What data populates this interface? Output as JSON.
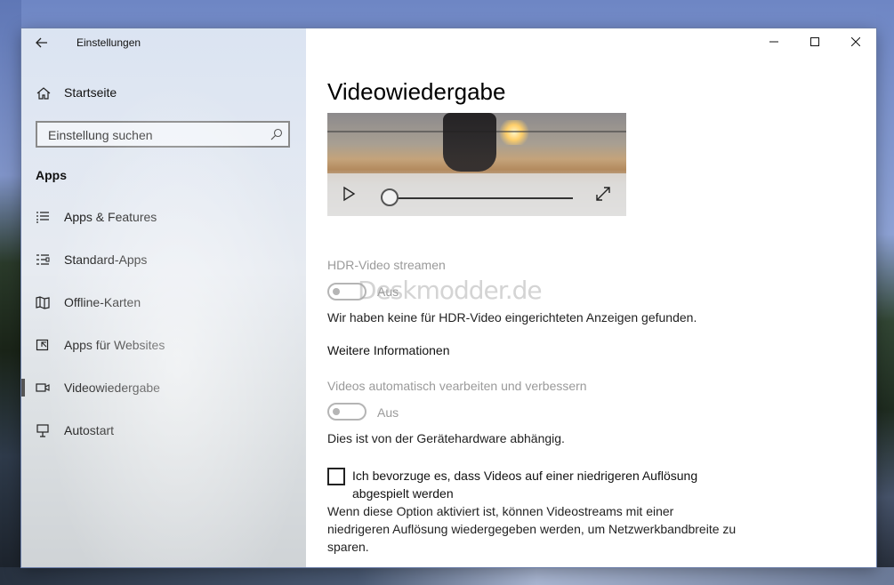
{
  "window": {
    "title": "Einstellungen",
    "back_label": "←",
    "minimize_glyph": "—",
    "maximize_glyph": "☐",
    "close_glyph": "✕"
  },
  "sidebar": {
    "home_label": "Startseite",
    "search_placeholder": "Einstellung suchen",
    "section_title": "Apps",
    "items": [
      {
        "label": "Apps & Features",
        "icon": "list-icon"
      },
      {
        "label": "Standard-Apps",
        "icon": "default-apps-icon"
      },
      {
        "label": "Offline-Karten",
        "icon": "map-icon"
      },
      {
        "label": "Apps für Websites",
        "icon": "open-in-app-icon"
      },
      {
        "label": "Videowiedergabe",
        "icon": "video-icon",
        "active": true
      },
      {
        "label": "Autostart",
        "icon": "startup-icon"
      }
    ]
  },
  "main": {
    "title": "Videowiedergabe",
    "player": {
      "seek_position": 0.0
    },
    "hdr": {
      "label": "HDR-Video streamen",
      "state": "Aus",
      "description": "Wir haben keine für HDR-Video eingerichteten Anzeigen gefunden.",
      "enabled": false
    },
    "more_info_link": "Weitere Informationen",
    "auto_process": {
      "label": "Videos automatisch vearbeiten und verbessern",
      "state": "Aus",
      "description": "Dies ist von der Gerätehardware abhängig.",
      "enabled": false
    },
    "low_res": {
      "label": "Ich bevorzuge es, dass Videos auf einer niedrigeren Auflösung abgespielt werden",
      "description": "Wenn diese Option aktiviert ist, können Videostreams mit einer niedrigeren Auflösung wiedergegeben werden, um Netzwerkbandbreite zu sparen.",
      "checked": false
    },
    "watermark": "Deskmodder.de"
  }
}
